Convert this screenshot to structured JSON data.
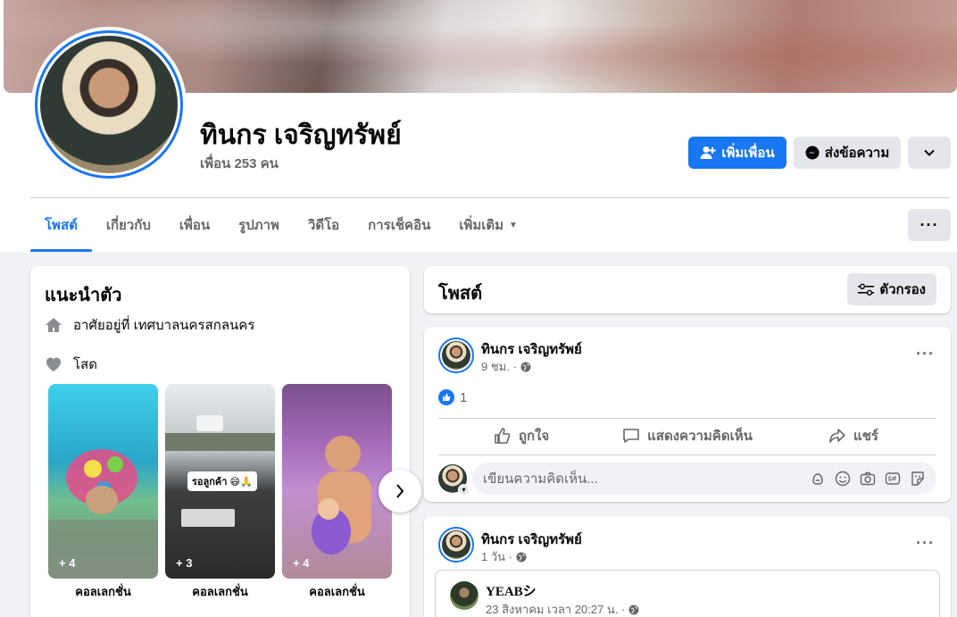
{
  "profile": {
    "name": "ทินกร เจริญทรัพย์",
    "friends": "เพื่อน 253 คน"
  },
  "actions": {
    "add_friend": "เพิ่มเพื่อน",
    "message": "ส่งข้อความ"
  },
  "tabs": [
    {
      "label": "โพสต์"
    },
    {
      "label": "เกี่ยวกับ"
    },
    {
      "label": "เพื่อน"
    },
    {
      "label": "รูปภาพ"
    },
    {
      "label": "วิดีโอ"
    },
    {
      "label": "การเช็คอิน"
    },
    {
      "label": "เพิ่มเติม"
    }
  ],
  "intro": {
    "title": "แนะนำตัว",
    "lives_in": "อาศัยอยู่ที่ เทศบาลนครสกลนคร",
    "relationship": "โสด",
    "highlights": [
      {
        "count": "+ 4",
        "label": "คอลเลกชั่น"
      },
      {
        "count": "+ 3",
        "label": "คอลเลกชั่น",
        "sticker": "รอลูกค้า 😄🙏"
      },
      {
        "count": "+ 4",
        "label": "คอลเลกชั่น"
      }
    ]
  },
  "posts_section": {
    "title": "โพสต์",
    "filter": "ตัวกรอง"
  },
  "posts": [
    {
      "author": "ทินกร เจริญทรัพย์",
      "time": "9 ชม. ·",
      "reaction_count": "1",
      "like": "ถูกใจ",
      "comment": "แสดงความคิดเห็น",
      "share": "แชร์",
      "comment_placeholder": "เขียนความคิดเห็น..."
    },
    {
      "author": "ทินกร เจริญทรัพย์",
      "time": "1 วัน ·",
      "shared_author": "YEABシ",
      "shared_time": "23 สิงหาคม เวลา 20:27 น. ·"
    }
  ],
  "colors": {
    "accent": "#1877f2",
    "background": "#f0f2f5",
    "secondary_text": "#65676b"
  }
}
